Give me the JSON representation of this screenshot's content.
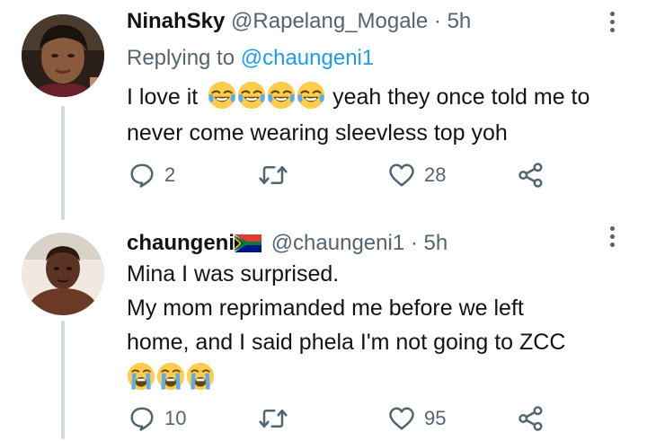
{
  "tweets": [
    {
      "display_name": "NinahSky",
      "handle": "@Rapelang_Mogale",
      "separator": "·",
      "time": "5h",
      "replying_prefix": "Replying to",
      "replying_to": "@chaungeni1",
      "text_line1_start": "I love it",
      "text_line1_end": "yeah they once told me to",
      "text_line2": "never come wearing sleevless top yoh",
      "emoji": "face-with-tears-of-joy",
      "reply_count": "2",
      "retweet_count": "",
      "like_count": "28"
    },
    {
      "display_name": "chaungeni",
      "handle": "@chaungeni1",
      "separator": "·",
      "time": "5h",
      "text_lines": [
        "Mina I was surprised.",
        "My mom reprimanded me before we left",
        "home, and I said phela I'm not going to ZCC"
      ],
      "emoji": "loudly-crying-face",
      "reply_count": "10",
      "retweet_count": "",
      "like_count": "95"
    }
  ],
  "icons": {
    "reply": "speech-bubble-icon",
    "retweet": "retweet-icon",
    "like": "heart-icon",
    "share": "share-icon",
    "more": "more-vertical-icon",
    "flag": "south-africa-flag-icon"
  },
  "colors": {
    "text": "#0f1419",
    "secondary": "#536471",
    "link": "#1d9bf0",
    "thread_line": "#cfd9de"
  }
}
